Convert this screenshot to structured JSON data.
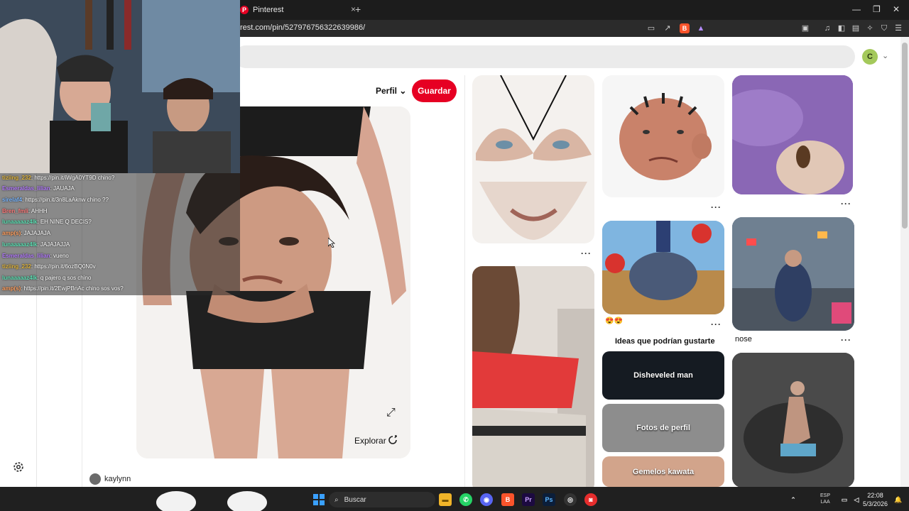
{
  "browser": {
    "tab_title": "Pinterest",
    "tab_close": "×",
    "new_tab": "+",
    "url": "rest.com/pin/527976756322639986/",
    "window_controls": [
      "—",
      "❐",
      "✕"
    ]
  },
  "pinterest": {
    "avatar_letter": "C",
    "perfil_label": "Perfil",
    "guardar_label": "Guardar",
    "explorar_label": "Explorar",
    "author": "kaylynn",
    "ideas_heading": "Ideas que podrían gustarte",
    "pin_caption_nose": "nose",
    "more_dots": "···",
    "emoji_reaction": "😍😍",
    "boards": [
      {
        "label": "Disheveled man"
      },
      {
        "label": "Fotos de perfil"
      },
      {
        "label": "Gemelos kawata"
      }
    ]
  },
  "chat": [
    {
      "user": "tiziing_232",
      "text": ": https://pin.it/iWgA0YT9D chino?",
      "color": "#e0b43a"
    },
    {
      "user": "Esmeraldas_lilian",
      "text": ": JAUAJA",
      "color": "#b57cff"
    },
    {
      "user": "sirelaf4",
      "text": ": https://pin.it/3n8LaAknw chino ??",
      "color": "#7ab6ff"
    },
    {
      "user": "Bren_fmli",
      "text": ": AHHH",
      "color": "#ff7a7a"
    },
    {
      "user": "amp(s)",
      "text": ": JAJAJAJA",
      "color": "#ff9d5c"
    },
    {
      "user": "lunaaaaaz4lk",
      "text": ": EH NINE Q DECIS?",
      "color": "#5ce0b4"
    },
    {
      "user": "lunaaaaaz4lk",
      "text": ": JAJAJAJJA",
      "color": "#5ce0b4"
    },
    {
      "user": "Esmeraldas_lilian",
      "text": ": vueno",
      "color": "#b57cff"
    },
    {
      "user": "tiziing_232",
      "text": ": https://pin.it/6ozBQ0N0v",
      "color": "#e0b43a"
    },
    {
      "user": "lunaaaaaz4lk",
      "text": ": q pajero q sos chino",
      "color": "#5ce0b4"
    },
    {
      "user": "amp(s)",
      "text": ": https://pin.it/2EwjPBnAc chino sos vos?",
      "color": "#ff9d5c"
    }
  ],
  "taskbar": {
    "search_placeholder": "Buscar",
    "time": "22:08",
    "date": "5/3/2026",
    "lang_line1": "ESP",
    "lang_line2": "LAA"
  },
  "colors": {
    "accent_red": "#e60023",
    "page_bg": "#ffffff",
    "chrome_dark": "#1c1c1c"
  }
}
